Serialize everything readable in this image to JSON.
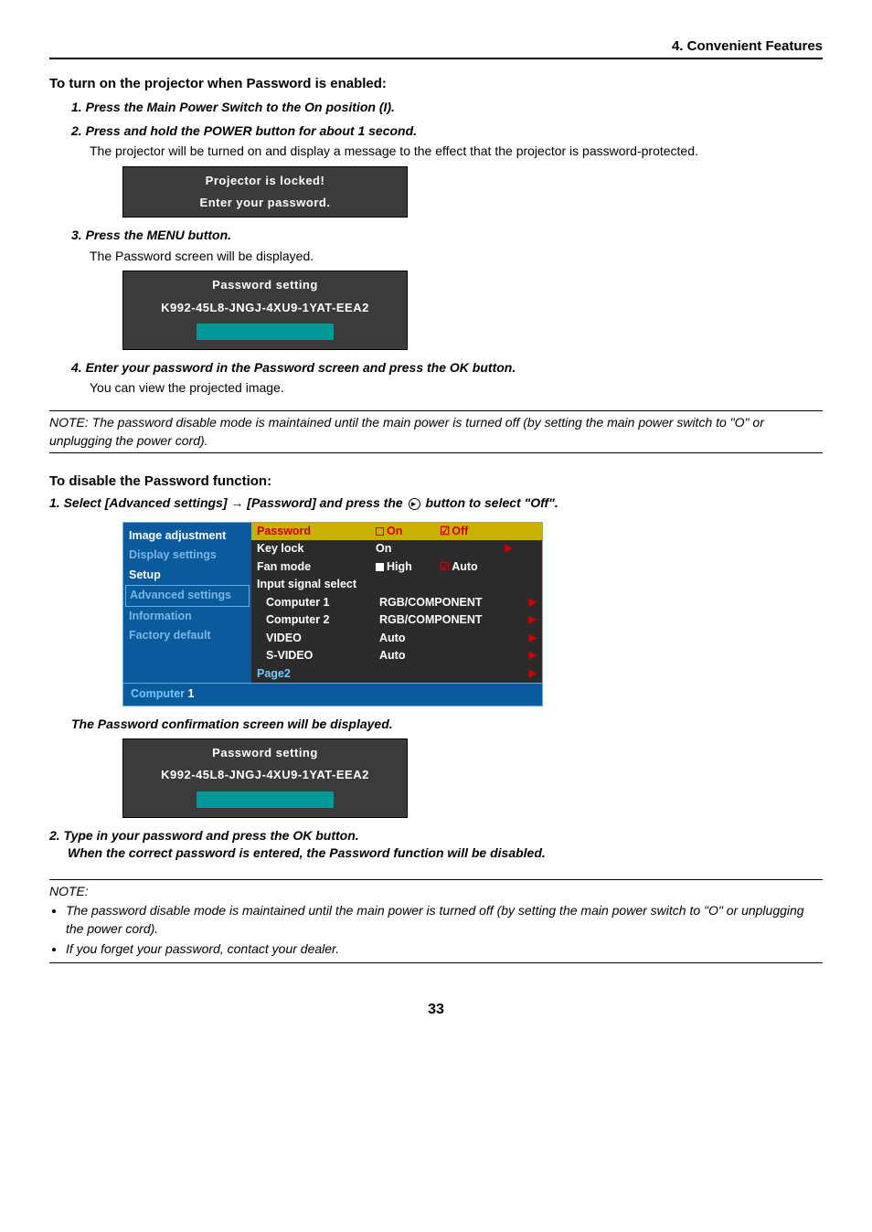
{
  "header": {
    "section": "4. Convenient Features"
  },
  "h1": "To turn on the projector when Password is enabled:",
  "steps1": {
    "s1": "1.  Press the Main Power Switch to the On position (I).",
    "s2": "2.  Press and hold the POWER  button for about 1 second.",
    "s2body": "The projector will be turned on and display a message to the effect that the projector is password-protected.",
    "s3": "3.  Press the MENU button.",
    "s3body": "The Password screen will be displayed.",
    "s4": "4.  Enter your password in the Password screen and press the OK button.",
    "s4body": "You can view the projected image."
  },
  "osd1": {
    "line1": "Projector is locked!",
    "line2": "Enter your password."
  },
  "osd2": {
    "title": "Password setting",
    "code": "K992-45L8-JNGJ-4XU9-1YAT-EEA2"
  },
  "note1": "NOTE: The password disable mode is maintained until the main power is turned off (by setting the main power switch to \"O\" or unplugging the power cord).",
  "h2": "To disable the Password function:",
  "step_disable_1a": "1. Select [Advanced settings] ",
  "step_disable_1b": " [Password] and press the ",
  "step_disable_1c": " button to select \"Off\".",
  "arrow": "→",
  "menu": {
    "left": [
      "Image adjustment",
      "Display settings",
      "Setup",
      "Advanced settings",
      "Information",
      "Factory default"
    ],
    "rows": [
      {
        "label": "Password",
        "c1": "On",
        "c2": "Off",
        "hl": true,
        "arrow": ""
      },
      {
        "label": "Key lock",
        "c1": "On",
        "c2": "",
        "arrow": "▶"
      },
      {
        "label": "Fan mode",
        "c1": "High",
        "c2": "Auto",
        "arrow": "",
        "box1": true,
        "check2": true
      },
      {
        "label": "Input signal select",
        "c1": "",
        "c2": "",
        "arrow": ""
      },
      {
        "label": "Computer 1",
        "c1": "RGB/COMPONENT",
        "c2": "",
        "arrow": "▶",
        "wide": true
      },
      {
        "label": "Computer 2",
        "c1": "RGB/COMPONENT",
        "c2": "",
        "arrow": "▶",
        "wide": true
      },
      {
        "label": "VIDEO",
        "c1": "Auto",
        "c2": "",
        "arrow": "▶"
      },
      {
        "label": "S-VIDEO",
        "c1": "Auto",
        "c2": "",
        "arrow": "▶"
      },
      {
        "label": "Page2",
        "c1": "",
        "c2": "",
        "arrow": "▶"
      }
    ],
    "footer_a": "Computer",
    "footer_b": "1"
  },
  "confirm_step": "The Password confirmation screen will be displayed.",
  "osd3": {
    "title": "Password setting",
    "code": "K992-45L8-JNGJ-4XU9-1YAT-EEA2"
  },
  "step_disable_2a": "2.  Type in your password and press the OK button.",
  "step_disable_2b": "When the correct password is entered, the Password function will be disabled.",
  "note2": {
    "heading": "NOTE:",
    "items": [
      "The password disable mode is maintained until the main power is turned off (by setting the main power switch to \"O\" or unplugging the power cord).",
      "If you forget your password, contact your dealer."
    ]
  },
  "page": "33"
}
